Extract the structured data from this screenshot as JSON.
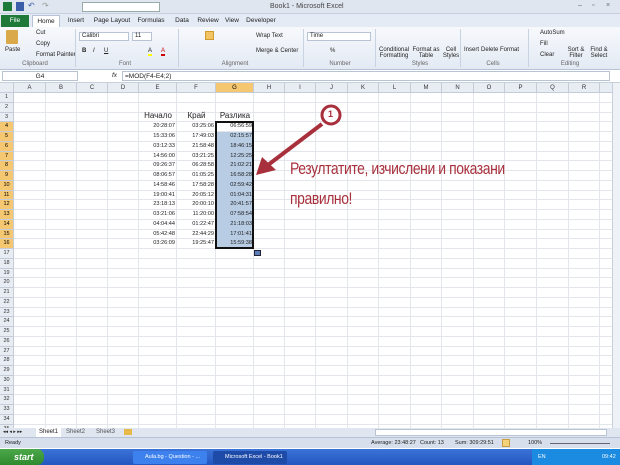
{
  "window": {
    "title": "Book1 - Microsoft Excel"
  },
  "tabs": [
    "File",
    "Home",
    "Insert",
    "Page Layout",
    "Formulas",
    "Data",
    "Review",
    "View",
    "Developer"
  ],
  "ribbon": {
    "clipboard": {
      "paste": "Paste",
      "cut": "Cut",
      "copy": "Copy",
      "format_painter": "Format Painter",
      "group": "Clipboard"
    },
    "font": {
      "name": "Calibri",
      "size": "11",
      "group": "Font"
    },
    "alignment": {
      "wrap": "Wrap Text",
      "merge": "Merge & Center",
      "group": "Alignment"
    },
    "number": {
      "format": "Time",
      "percent": "%",
      "group": "Number"
    },
    "styles": {
      "conditional": "Conditional Formatting",
      "table": "Format as Table",
      "cell": "Cell Styles",
      "group": "Styles"
    },
    "cells": {
      "insert": "Insert",
      "delete": "Delete",
      "format": "Format",
      "group": "Cells"
    },
    "editing": {
      "autosum": "AutoSum",
      "fill": "Fill",
      "clear": "Clear",
      "sort": "Sort & Filter",
      "find": "Find & Select",
      "group": "Editing"
    }
  },
  "formula_bar": {
    "name_box": "G4",
    "fx": "fx",
    "formula": "=MOD(F4-E4;2)"
  },
  "columns": [
    "A",
    "B",
    "C",
    "D",
    "E",
    "F",
    "G",
    "H",
    "I",
    "J",
    "K",
    "L",
    "M",
    "N",
    "O",
    "P",
    "Q",
    "R",
    "S"
  ],
  "selected_column": "G",
  "headers": {
    "E": "Начало",
    "F": "Край",
    "G": "Разлика"
  },
  "table": [
    [
      "20:28:07",
      "03:25:06",
      "06:56:59"
    ],
    [
      "15:33:06",
      "17:49:03",
      "02:15:57"
    ],
    [
      "03:12:33",
      "21:58:48",
      "18:46:15"
    ],
    [
      "14:56:00",
      "03:21:25",
      "12:25:25"
    ],
    [
      "09:26:37",
      "06:28:58",
      "21:02:21"
    ],
    [
      "08:06:57",
      "01:05:25",
      "16:58:28"
    ],
    [
      "14:58:46",
      "17:58:28",
      "02:59:42"
    ],
    [
      "19:00:41",
      "20:05:12",
      "01:04:31"
    ],
    [
      "23:18:13",
      "20:00:10",
      "20:41:57"
    ],
    [
      "03:21:06",
      "11:20:00",
      "07:58:54"
    ],
    [
      "04:04:44",
      "01:22:47",
      "21:18:03"
    ],
    [
      "05:42:48",
      "22:44:29",
      "17:01:41"
    ],
    [
      "03:26:09",
      "19:25:47",
      "15:59:38"
    ]
  ],
  "annotation": {
    "number": "1",
    "line1": "Резултатите, изчислени и показани",
    "line2": "правилно!",
    "color": "#a8303c"
  },
  "sheets": [
    "Sheet1",
    "Sheet2",
    "Sheet3"
  ],
  "status": {
    "mode": "Ready",
    "average": "Average: 23:48:27",
    "count": "Count: 13",
    "sum": "Sum: 309:29:51",
    "zoom": "100%"
  },
  "taskbar": {
    "start": "start",
    "tasks": [
      "Aula.bg - Question - ...",
      "Microsoft Excel - Book1"
    ],
    "lang": "EN",
    "time": "09:42"
  }
}
